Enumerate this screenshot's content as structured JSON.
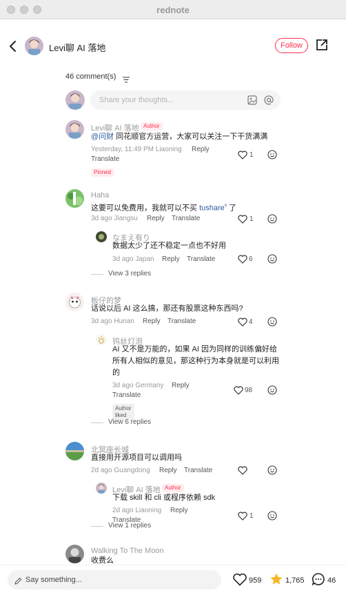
{
  "window": {
    "title": "rednote"
  },
  "header": {
    "author_name": "Levi聊 AI 落地",
    "follow_label": "Follow"
  },
  "comments_header": {
    "count_label": "46 comment(s)"
  },
  "share_box": {
    "placeholder": "Share your thoughts..."
  },
  "comments": [
    {
      "name": "Levi聊 AI 落地",
      "author_tag": "Author",
      "text_mention": "@问财",
      "text": " 同花顺官方运营，大家可以关注一下干货满满",
      "meta": "Yesterday, 11:49 PM Liaoning",
      "reply": "Reply",
      "translate": "Translate",
      "likes": "1",
      "pinned": "Pinned"
    },
    {
      "name": "Haha",
      "text": "这要可以免费用，我就可以不买 ",
      "text_link": "tushare",
      "text_after": " 了",
      "meta": "3d ago Jiangsu",
      "reply": "Reply",
      "translate": "Translate",
      "likes": "1",
      "replies": [
        {
          "name": "なまえ有り",
          "text": "数据太少了还不稳定一点也不好用",
          "meta": "3d ago Japan",
          "reply": "Reply",
          "translate": "Translate",
          "likes": "6"
        }
      ],
      "view_replies": "View 3 replies"
    },
    {
      "name": "板仔的梦",
      "text": "话说以后 AI 这么搞，那还有股票这种东西吗?",
      "meta": "3d ago Hunan",
      "reply": "Reply",
      "translate": "Translate",
      "likes": "4",
      "replies": [
        {
          "name": "钨丝灯泡",
          "text_lines": [
            "AI 又不是万能的，如果 AI 因为同样的训练偏好给",
            "所有人相似的意见，那这种行为本身就是可以利用",
            "的"
          ],
          "meta": "3d ago Germany",
          "reply": "Reply",
          "translate": "Translate",
          "likes": "98",
          "author_liked": "Author liked"
        }
      ],
      "view_replies": "View 6 replies"
    },
    {
      "name": "北冥座长城",
      "text": "直接用开源项目可以调用吗",
      "meta": "2d ago Guangdong",
      "reply": "Reply",
      "translate": "Translate",
      "likes": "",
      "replies": [
        {
          "name": "Levi聊 AI 落地",
          "author_tag": "Author",
          "text": "下载 skill 和 cli 或程序依赖 sdk",
          "meta": "2d ago Liaoning",
          "reply": "Reply",
          "translate": "Translate",
          "likes": "1"
        }
      ],
      "view_replies": "View 1 replies"
    },
    {
      "name": "Walking To The Moon",
      "text": "收费么"
    }
  ],
  "bottom_bar": {
    "placeholder": "Say something...",
    "likes": "959",
    "stars": "1,765",
    "comments": "46"
  },
  "colors": {
    "accent": "#ff2e4d",
    "link": "#2b5a9c",
    "star": "#f5b824"
  },
  "icons": [
    "back-icon",
    "share-icon",
    "sort-icon",
    "image-icon",
    "at-icon",
    "heart-icon",
    "emoji-icon",
    "pencil-icon",
    "star-icon",
    "chat-icon"
  ]
}
